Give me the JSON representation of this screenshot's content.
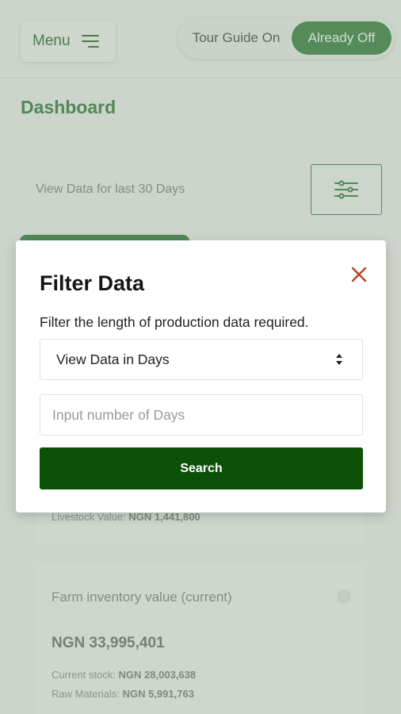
{
  "header": {
    "menu_label": "Menu",
    "tour_guide_on_label": "Tour Guide On",
    "tour_guide_off_label": "Already Off"
  },
  "dashboard": {
    "title": "Dashboard",
    "range_text": "View Data for last 30 Days"
  },
  "cards": {
    "livestock_label": "Livestock Value:",
    "livestock_value": "NGN 1,441,800",
    "inventory_title": "Farm inventory value (current)",
    "inventory_value": "NGN 33,995,401",
    "current_stock_label": "Current stock:",
    "current_stock_value": "NGN 28,003,638",
    "raw_materials_label": "Raw Materials:",
    "raw_materials_value": "NGN 5,991,763"
  },
  "modal": {
    "title": "Filter Data",
    "description": "Filter the length of production data required.",
    "select_value": "View Data in Days",
    "input_placeholder": "Input number of Days",
    "search_label": "Search"
  },
  "icons": {
    "menu": "hamburger-icon",
    "filter": "sliders-icon",
    "close": "close-icon",
    "select": "up-down-chevron-icon"
  },
  "colors": {
    "brand_green": "#4a8c4f",
    "search_button": "#0b5208",
    "close_icon": "#b8431e"
  }
}
